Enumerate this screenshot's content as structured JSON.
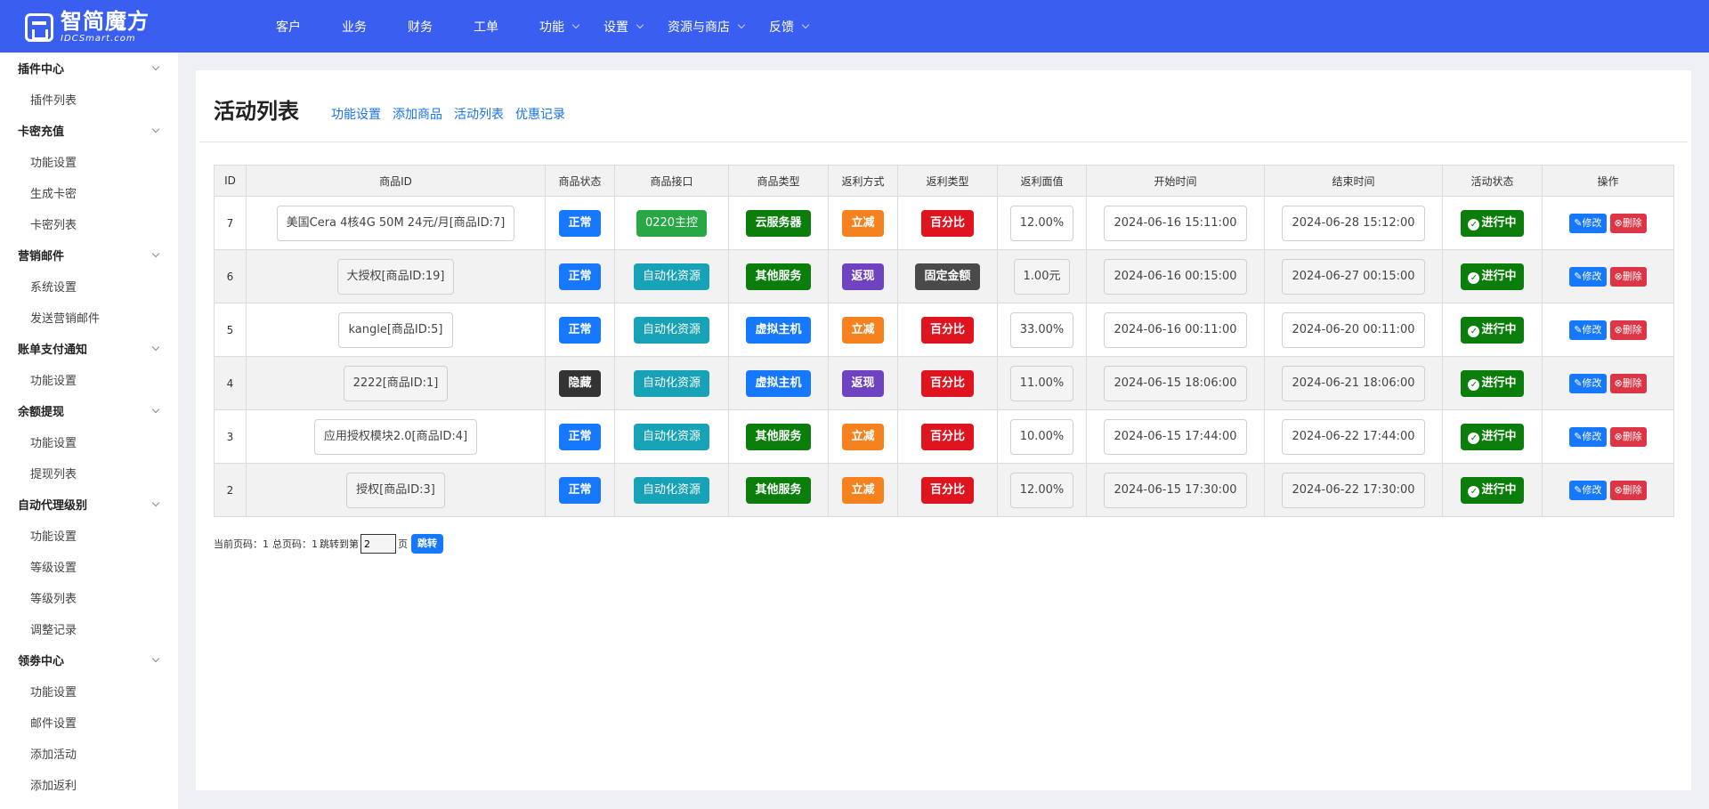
{
  "brand": {
    "name": "智简魔方",
    "sub": "IDCSmart.com"
  },
  "nav": [
    {
      "label": "客户",
      "dropdown": false
    },
    {
      "label": "业务",
      "dropdown": false
    },
    {
      "label": "财务",
      "dropdown": false
    },
    {
      "label": "工单",
      "dropdown": false
    },
    {
      "label": "功能",
      "dropdown": true
    },
    {
      "label": "设置",
      "dropdown": true
    },
    {
      "label": "资源与商店",
      "dropdown": true
    },
    {
      "label": "反馈",
      "dropdown": true
    }
  ],
  "sidebar": [
    {
      "type": "group",
      "label": "插件中心"
    },
    {
      "type": "item",
      "label": "插件列表"
    },
    {
      "type": "group",
      "label": "卡密充值"
    },
    {
      "type": "item",
      "label": "功能设置"
    },
    {
      "type": "item",
      "label": "生成卡密"
    },
    {
      "type": "item",
      "label": "卡密列表"
    },
    {
      "type": "group",
      "label": "营销邮件"
    },
    {
      "type": "item",
      "label": "系统设置"
    },
    {
      "type": "item",
      "label": "发送营销邮件"
    },
    {
      "type": "group",
      "label": "账单支付通知"
    },
    {
      "type": "item",
      "label": "功能设置"
    },
    {
      "type": "group",
      "label": "余额提现"
    },
    {
      "type": "item",
      "label": "功能设置"
    },
    {
      "type": "item",
      "label": "提现列表"
    },
    {
      "type": "group",
      "label": "自动代理级别"
    },
    {
      "type": "item",
      "label": "功能设置"
    },
    {
      "type": "item",
      "label": "等级设置"
    },
    {
      "type": "item",
      "label": "等级列表"
    },
    {
      "type": "item",
      "label": "调整记录"
    },
    {
      "type": "group",
      "label": "领劵中心"
    },
    {
      "type": "item",
      "label": "功能设置"
    },
    {
      "type": "item",
      "label": "邮件设置"
    },
    {
      "type": "item",
      "label": "添加活动"
    },
    {
      "type": "item",
      "label": "添加返利"
    }
  ],
  "page": {
    "title": "活动列表",
    "links": [
      "功能设置",
      "添加商品",
      "活动列表",
      "优惠记录"
    ]
  },
  "table": {
    "headers": [
      "ID",
      "商品ID",
      "商品状态",
      "商品接口",
      "商品类型",
      "返利方式",
      "返利类型",
      "返利面值",
      "开始时间",
      "结束时间",
      "活动状态",
      "操作"
    ],
    "edit_label": "修改",
    "delete_label": "删除",
    "rows": [
      {
        "id": "7",
        "product": "美国Cera 4核4G 50M 24元/月[商品ID:7]",
        "status": "正常",
        "status_color": "blue",
        "api": "0220主控",
        "api_color": "green2",
        "type": "云服务器",
        "type_color": "green",
        "method": "立减",
        "method_color": "orange",
        "rebate_type": "百分比",
        "rebate_color": "red",
        "value": "12.00%",
        "start": "2024-06-16 15:11:00",
        "end": "2024-06-28 15:12:00",
        "state": "进行中"
      },
      {
        "id": "6",
        "product": "大授权[商品ID:19]",
        "status": "正常",
        "status_color": "blue",
        "api": "自动化资源",
        "api_color": "teal",
        "type": "其他服务",
        "type_color": "green",
        "method": "返现",
        "method_color": "purple",
        "rebate_type": "固定金额",
        "rebate_color": "grey",
        "value": "1.00元",
        "start": "2024-06-16 00:15:00",
        "end": "2024-06-27 00:15:00",
        "state": "进行中"
      },
      {
        "id": "5",
        "product": "kangle[商品ID:5]",
        "status": "正常",
        "status_color": "blue",
        "api": "自动化资源",
        "api_color": "teal",
        "type": "虚拟主机",
        "type_color": "blue",
        "method": "立减",
        "method_color": "orange",
        "rebate_type": "百分比",
        "rebate_color": "red",
        "value": "33.00%",
        "start": "2024-06-16 00:11:00",
        "end": "2024-06-20 00:11:00",
        "state": "进行中"
      },
      {
        "id": "4",
        "product": "2222[商品ID:1]",
        "status": "隐藏",
        "status_color": "dark",
        "api": "自动化资源",
        "api_color": "teal",
        "type": "虚拟主机",
        "type_color": "blue",
        "method": "返现",
        "method_color": "purple",
        "rebate_type": "百分比",
        "rebate_color": "red",
        "value": "11.00%",
        "start": "2024-06-15 18:06:00",
        "end": "2024-06-21 18:06:00",
        "state": "进行中"
      },
      {
        "id": "3",
        "product": "应用授权模块2.0[商品ID:4]",
        "status": "正常",
        "status_color": "blue",
        "api": "自动化资源",
        "api_color": "teal",
        "type": "其他服务",
        "type_color": "green",
        "method": "立减",
        "method_color": "orange",
        "rebate_type": "百分比",
        "rebate_color": "red",
        "value": "10.00%",
        "start": "2024-06-15 17:44:00",
        "end": "2024-06-22 17:44:00",
        "state": "进行中"
      },
      {
        "id": "2",
        "product": "授权[商品ID:3]",
        "status": "正常",
        "status_color": "blue",
        "api": "自动化资源",
        "api_color": "teal",
        "type": "其他服务",
        "type_color": "green",
        "method": "立减",
        "method_color": "orange",
        "rebate_type": "百分比",
        "rebate_color": "red",
        "value": "12.00%",
        "start": "2024-06-15 17:30:00",
        "end": "2024-06-22 17:30:00",
        "state": "进行中"
      }
    ]
  },
  "pager": {
    "current_label": "当前页码：1",
    "total_label": "总页码：1",
    "jump_prefix": "跳转到第",
    "jump_value": "2",
    "page_suffix": "页",
    "jump_button": "跳转"
  }
}
